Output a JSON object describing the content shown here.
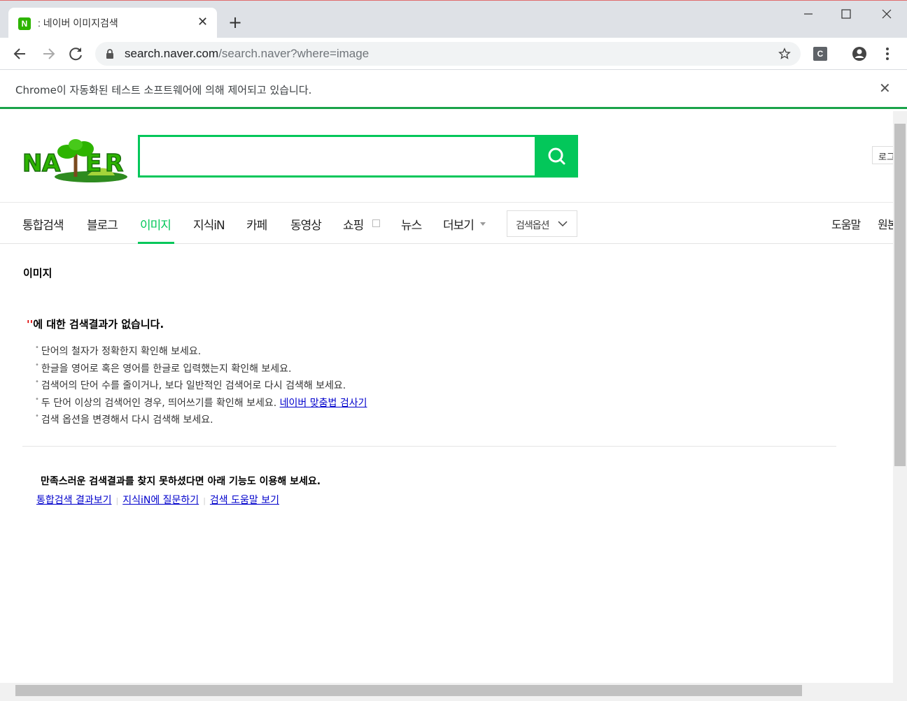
{
  "browser": {
    "tab_favicon": "N",
    "tab_title": ": 네이버 이미지검색",
    "tab_close": "✕",
    "new_tab": "+",
    "url_host": "search.naver.com",
    "url_rest": "/search.naver?where=image",
    "profile_badge": "C",
    "infobar_text": "Chrome이 자동화된 테스트 소프트웨어에 의해 제어되고 있습니다.",
    "infobar_close": "✕"
  },
  "header": {
    "search_value": "",
    "login_label": "로그"
  },
  "lnb": {
    "items": [
      "통합검색",
      "블로그",
      "이미지",
      "지식iN",
      "카페",
      "동영상",
      "쇼핑",
      "뉴스",
      "더보기"
    ],
    "active": "이미지",
    "options_label": "검색옵션",
    "help": "도움말",
    "right_cut": "원본"
  },
  "content": {
    "section_title": "이미지",
    "no_result_quote": "''",
    "no_result_text": "에 대한 검색결과가 없습니다.",
    "tips": [
      "단어의 철자가 정확한지 확인해 보세요.",
      "한글을 영어로 혹은 영어를 한글로 입력했는지 확인해 보세요.",
      "검색어의 단어 수를 줄이거나, 보다 일반적인 검색어로 다시 검색해 보세요.",
      "두 단어 이상의 검색어인 경우, 띄어쓰기를 확인해 보세요.",
      "검색 옵션을 변경해서 다시 검색해 보세요."
    ],
    "spell_link": "네이버 맞춤법 검사기",
    "alt_title": "만족스러운 검색결과를 찾지 못하셨다면 아래 기능도 이용해 보세요.",
    "alt_links": [
      "통합검색 결과보기",
      "지식iN에 질문하기",
      "검색 도움말 보기"
    ]
  },
  "colors": {
    "naver_green": "#03c75a",
    "link_blue": "#0000cc",
    "quote_red": "#dd0000"
  }
}
